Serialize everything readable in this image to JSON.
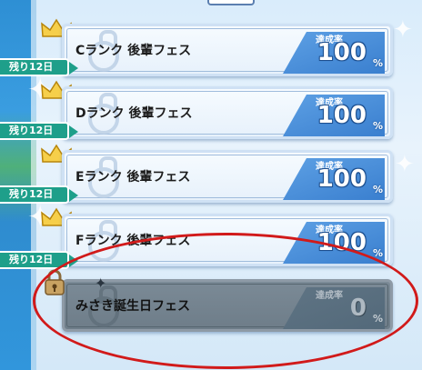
{
  "rate_label": "達成率",
  "percent_sign": "%",
  "cards": [
    {
      "title": "Cランク 後輩フェス",
      "rate": "100",
      "days_left": "残り12日",
      "locked": false
    },
    {
      "title": "Dランク 後輩フェス",
      "rate": "100",
      "days_left": "残り12日",
      "locked": false
    },
    {
      "title": "Eランク 後輩フェス",
      "rate": "100",
      "days_left": "残り12日",
      "locked": false
    },
    {
      "title": "Fランク 後輩フェス",
      "rate": "100",
      "days_left": "残り12日",
      "locked": false
    },
    {
      "title": "みさき誕生日フェス",
      "rate": "0",
      "locked": true
    }
  ],
  "icons": {
    "crown": "crown-icon",
    "lock": "lock-icon",
    "sparkle": "sparkle-icon"
  },
  "colors": {
    "rate_box": "#3a7fcf",
    "days_tag": "#1e9f8a",
    "annotation": "#d11a1a",
    "locked_card": "#6e7d89"
  }
}
